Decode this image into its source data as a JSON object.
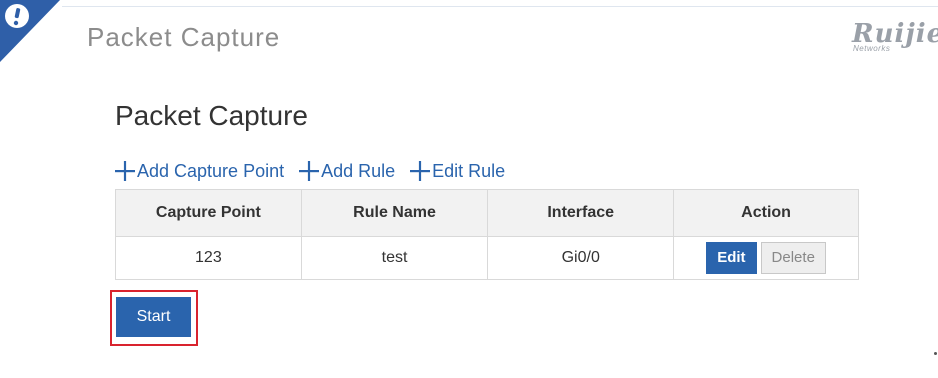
{
  "header": {
    "title": "Packet Capture",
    "badge_icon": "alert-icon",
    "brand": {
      "name": "Ruijie",
      "tagline": "Networks"
    }
  },
  "page": {
    "title": "Packet Capture"
  },
  "toolbar": {
    "add_capture_point": "Add Capture Point",
    "add_rule": "Add Rule",
    "edit_rule": "Edit Rule",
    "icon": "plus-icon"
  },
  "table": {
    "headers": [
      "Capture Point",
      "Rule Name",
      "Interface",
      "Action"
    ],
    "rows": [
      {
        "capture_point": "123",
        "rule_name": "test",
        "interface": "Gi0/0",
        "edit_label": "Edit",
        "delete_label": "Delete"
      }
    ]
  },
  "actions": {
    "start_label": "Start"
  },
  "colors": {
    "accent": "#2a64ad",
    "badge": "#2f5fa8",
    "highlight": "#d9232e",
    "header_bg": "#f2f2f2"
  }
}
